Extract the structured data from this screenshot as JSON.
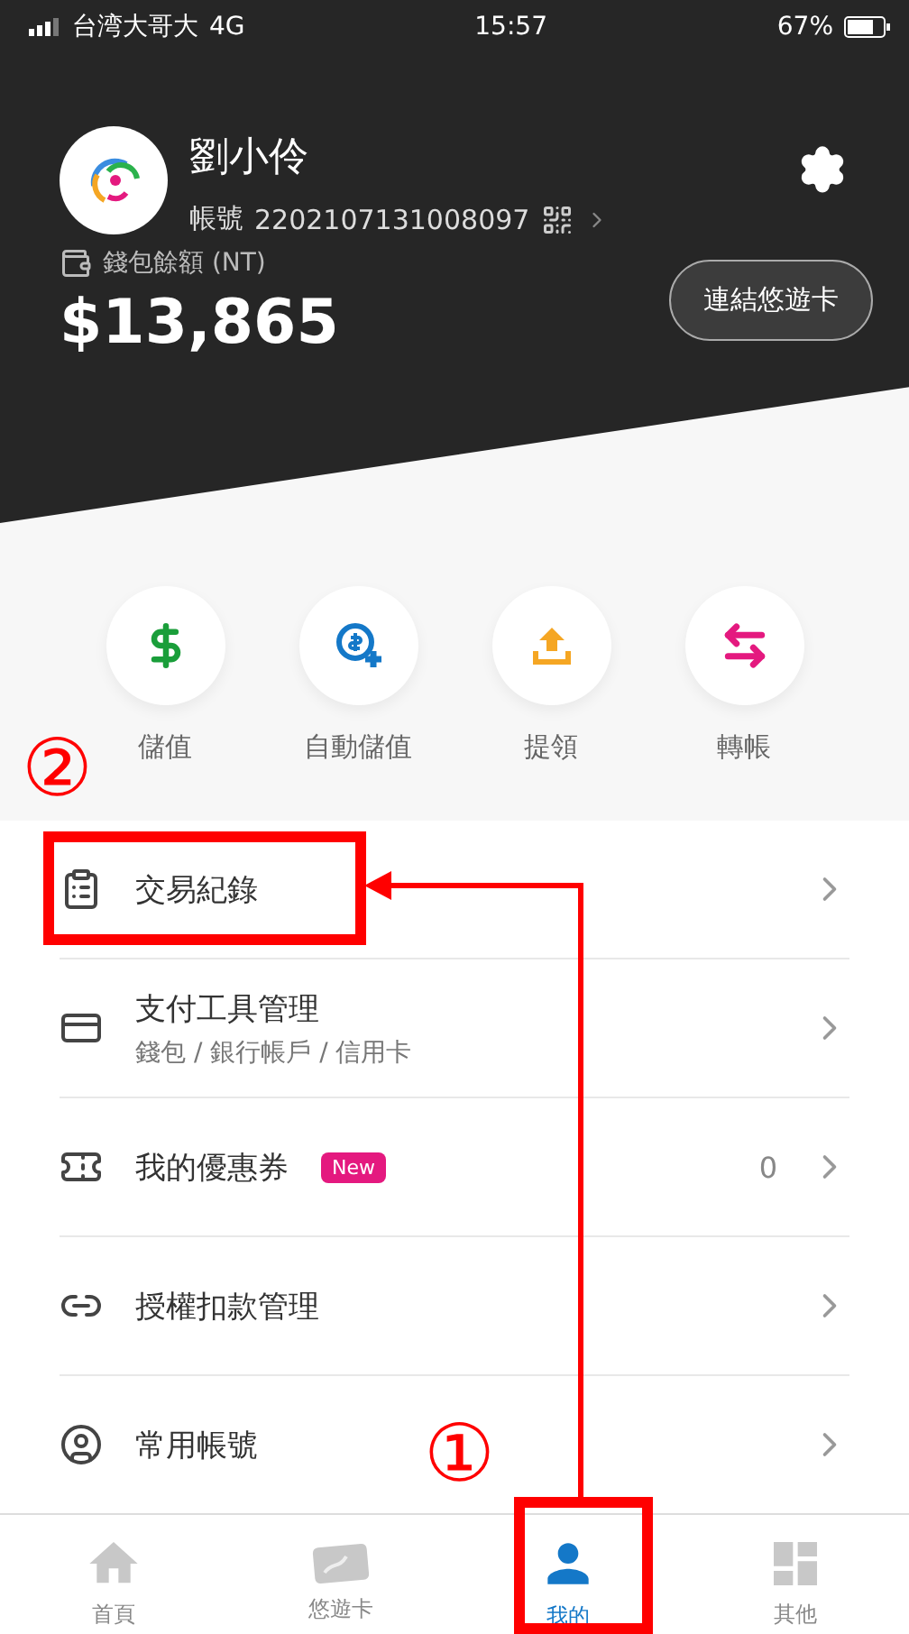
{
  "status_bar": {
    "carrier": "台湾大哥大",
    "network": "4G",
    "time": "15:57",
    "battery": "67%"
  },
  "profile": {
    "name": "劉小伶",
    "account_label": "帳號",
    "account_number": "2202107131008097",
    "balance_label": "錢包餘額 (NT)",
    "balance": "$13,865",
    "link_button": "連結悠遊卡"
  },
  "actions": [
    {
      "kind": "topup",
      "label": "儲值"
    },
    {
      "kind": "auto",
      "label": "自動儲值"
    },
    {
      "kind": "withdraw",
      "label": "提領"
    },
    {
      "kind": "transfer",
      "label": "轉帳"
    }
  ],
  "menu": [
    {
      "kind": "records",
      "label": "交易紀錄"
    },
    {
      "kind": "payment",
      "label": "支付工具管理",
      "subtitle": "錢包 / 銀行帳戶 / 信用卡"
    },
    {
      "kind": "coupon",
      "label": "我的優惠券",
      "badge": "New",
      "count": "0"
    },
    {
      "kind": "auth",
      "label": "授權扣款管理"
    },
    {
      "kind": "accounts",
      "label": "常用帳號"
    }
  ],
  "tabs": [
    {
      "kind": "home",
      "label": "首頁",
      "selected": false
    },
    {
      "kind": "card",
      "label": "悠遊卡",
      "selected": false
    },
    {
      "kind": "me",
      "label": "我的",
      "selected": true
    },
    {
      "kind": "other",
      "label": "其他",
      "selected": false
    }
  ],
  "annotations": [
    {
      "kind": "records",
      "label": "②"
    },
    {
      "kind": "tab",
      "label": "①"
    }
  ]
}
